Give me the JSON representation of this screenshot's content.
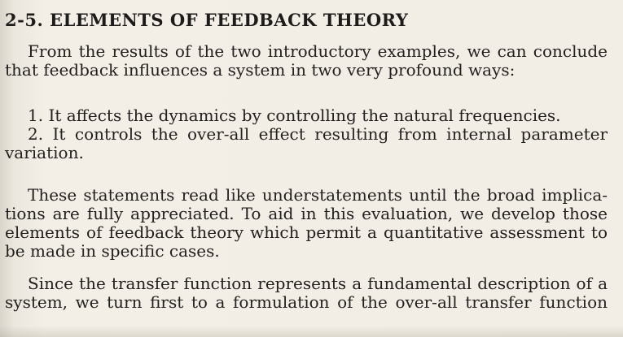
{
  "section": {
    "heading": "2-5. ELEMENTS OF FEEDBACK THEORY"
  },
  "paragraphs": [
    {
      "lines": [
        "From the results of the two introductory examples, we can conclude",
        "that feedback influences a system in two very profound ways:"
      ]
    },
    {
      "lines": [
        "1. It affects the dynamics by controlling the natural frequencies.",
        "2. It controls the over-all effect resulting from internal parameter",
        "variation."
      ]
    },
    {
      "lines": [
        "These statements read like understatements until the broad implica-",
        "tions are fully appreciated.  To aid in this evaluation, we develop those",
        "elements of feedback theory which permit a quantitative assessment to",
        "be made in specific cases."
      ]
    },
    {
      "lines": [
        "Since the transfer function represents a fundamental description of a",
        "system, we turn first to a formulation of the over-all transfer function"
      ]
    }
  ]
}
